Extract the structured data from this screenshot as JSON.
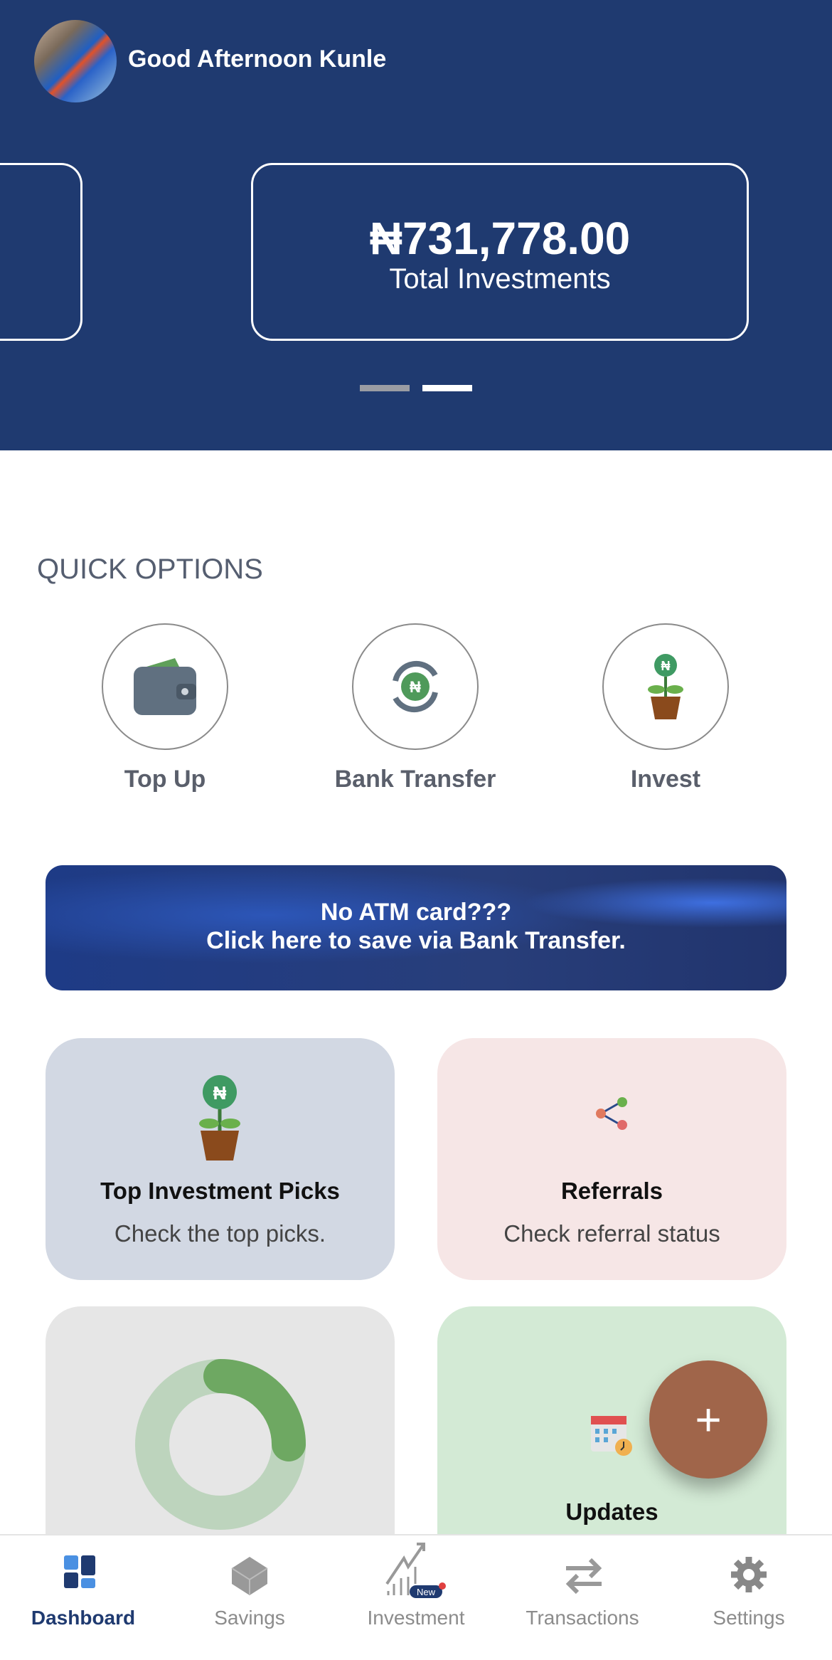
{
  "header": {
    "greeting": "Good Afternoon Kunle",
    "balance_card": {
      "amount": "₦731,778.00",
      "label": "Total Investments"
    },
    "carousel": {
      "pages": 2,
      "active": 2
    }
  },
  "quick_options": {
    "title": "QUICK OPTIONS",
    "items": [
      {
        "label": "Top Up",
        "icon": "wallet-icon"
      },
      {
        "label": "Bank Transfer",
        "icon": "naira-transfer-icon"
      },
      {
        "label": "Invest",
        "icon": "money-plant-icon"
      }
    ]
  },
  "banner": {
    "line1": "No ATM card???",
    "line2": "Click here to save via Bank Transfer."
  },
  "tiles": [
    {
      "title": "Top Investment Picks",
      "subtitle": "Check the top picks.",
      "icon": "money-plant-icon",
      "color": "#d2d8e3"
    },
    {
      "title": "Referrals",
      "subtitle": "Check referral status",
      "icon": "referral-network-icon",
      "color": "#f6e6e6"
    },
    {
      "title": "",
      "icon": "donut-progress",
      "color": "#e6e6e6"
    },
    {
      "title": "Updates",
      "icon": "calendar-clock-icon",
      "color": "#d3ead5"
    }
  ],
  "fab": {
    "label": "+"
  },
  "nav": {
    "items": [
      {
        "label": "Dashboard",
        "active": true
      },
      {
        "label": "Savings"
      },
      {
        "label": "Investment",
        "badge": "New"
      },
      {
        "label": "Transactions"
      },
      {
        "label": "Settings"
      }
    ]
  },
  "colors": {
    "primary": "#1f3a70",
    "fab": "#a0654a",
    "active_nav": "#1f3a70",
    "inactive_nav": "#8c8c8c"
  }
}
